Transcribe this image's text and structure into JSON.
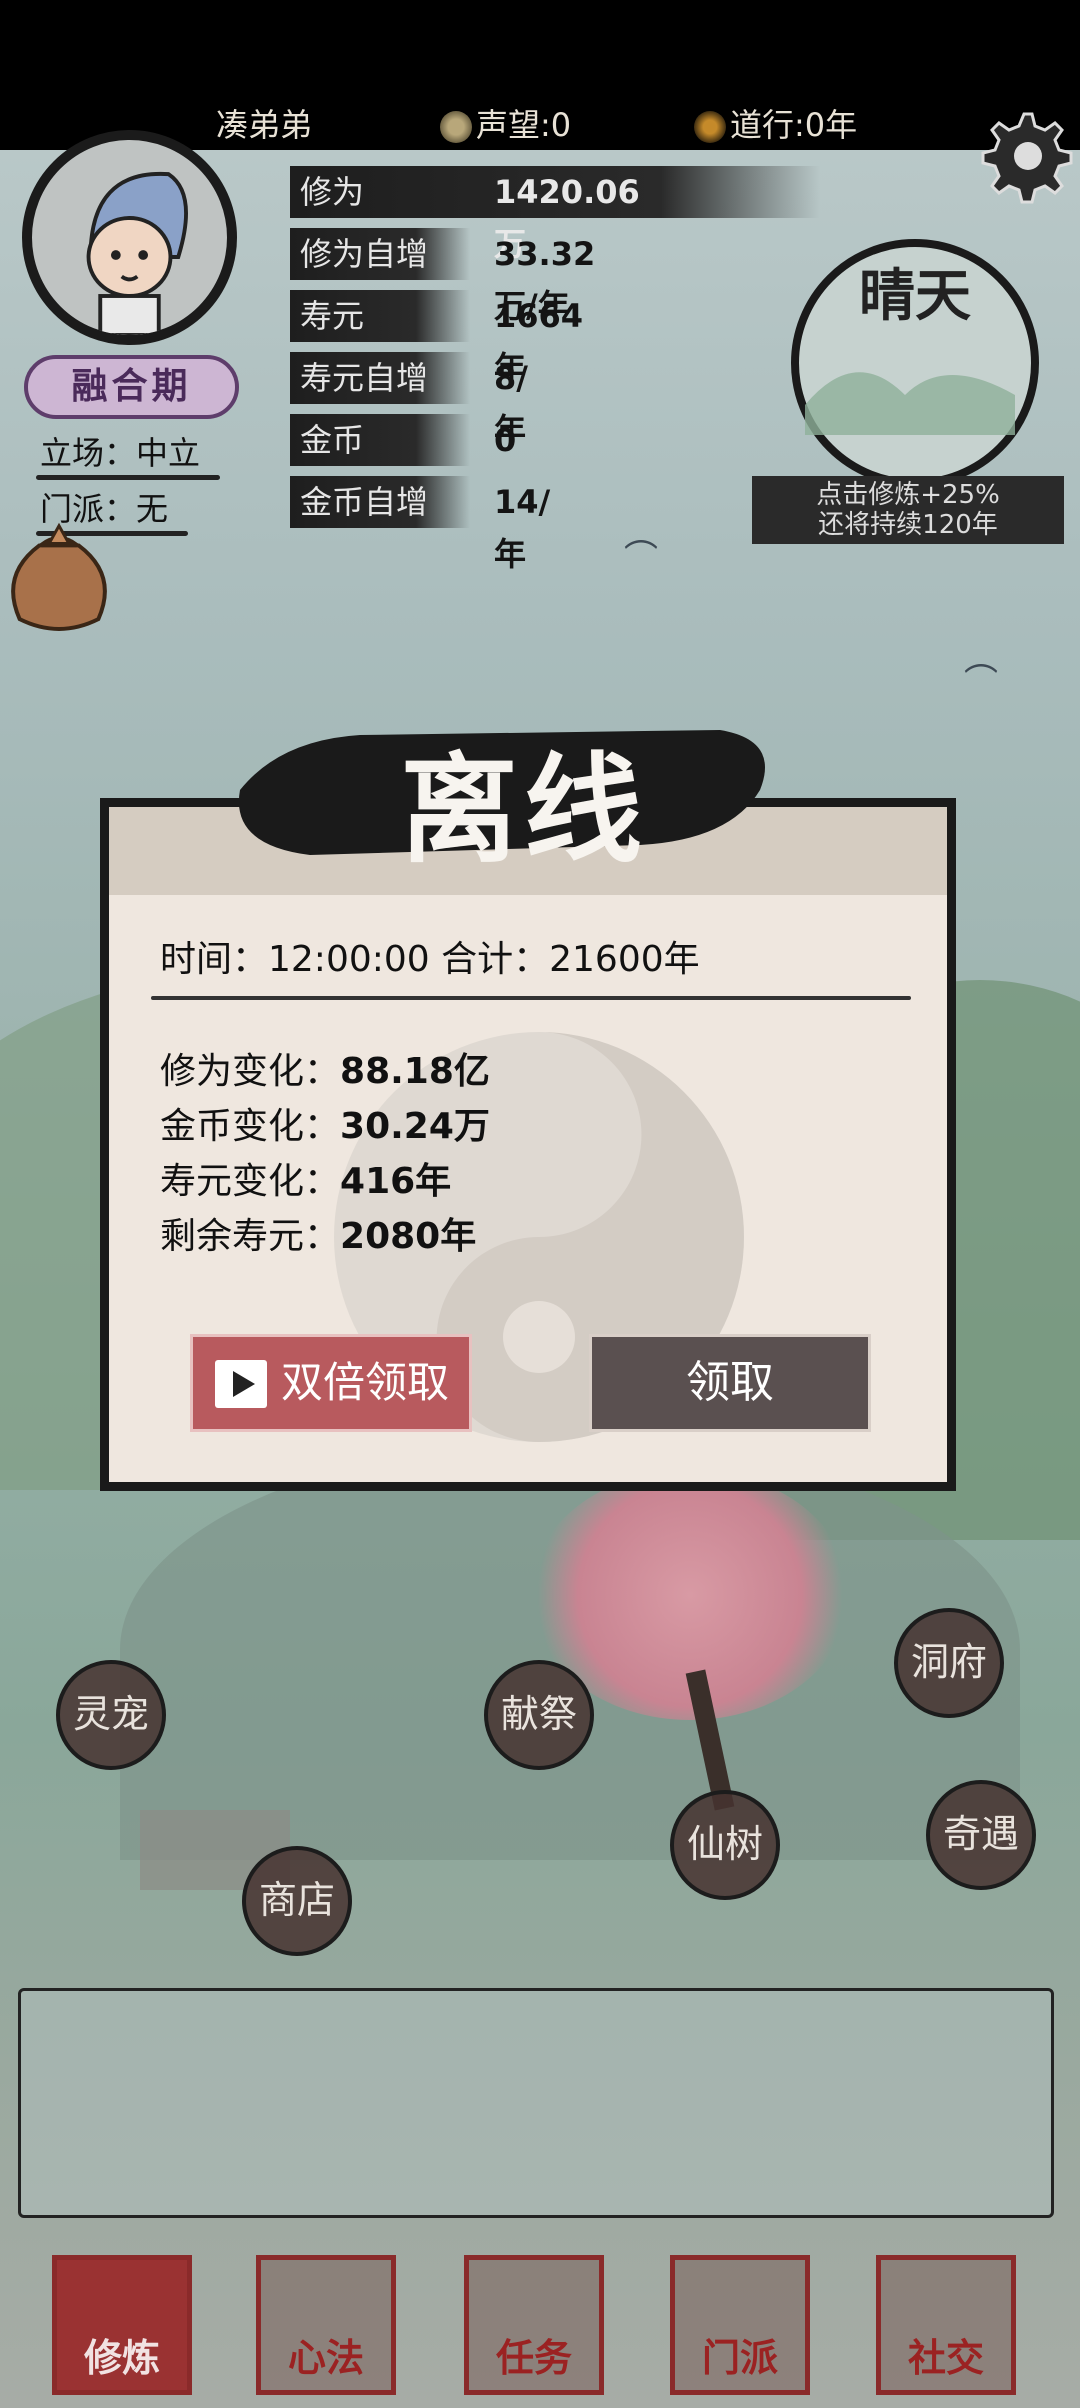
{
  "header": {
    "player_name": "凑弟弟",
    "reputation": "声望:0",
    "dao": "道行:0年"
  },
  "profile": {
    "rank": "融合期",
    "stance": "立场：中立",
    "sect": "门派：无"
  },
  "stats": [
    {
      "label": "修为",
      "value": "1420.06万"
    },
    {
      "label": "修为自增",
      "value": "33.32万/年"
    },
    {
      "label": "寿元",
      "value": "1664年"
    },
    {
      "label": "寿元自增",
      "value": "8/年"
    },
    {
      "label": "金币",
      "value": "0"
    },
    {
      "label": "金币自增",
      "value": "14/年"
    }
  ],
  "weather": {
    "name": "晴天",
    "line1": "点击修炼+25%",
    "line2": "还将持续120年"
  },
  "dialog": {
    "title": "离线",
    "time_row": "时间：12:00:00 合计：21600年",
    "changes": [
      {
        "label": "修为变化：",
        "value": "88.18亿"
      },
      {
        "label": "金币变化：",
        "value": "30.24万"
      },
      {
        "label": "寿元变化：",
        "value": "416年"
      },
      {
        "label": "剩余寿元：",
        "value": "2080年"
      }
    ],
    "double_label": "双倍领取",
    "claim_label": "领取"
  },
  "map_buttons": {
    "pet": "灵宠",
    "sacrifice": "献祭",
    "cave": "洞府",
    "shop": "商店",
    "tree": "仙树",
    "adventure": "奇遇"
  },
  "tabs": [
    "修炼",
    "心法",
    "任务",
    "门派",
    "社交"
  ],
  "colors": {
    "accent_red": "#9a3232",
    "double_button": "#b85a5e",
    "claim_button": "#5a5050",
    "dialog_bg": "#efe7df"
  },
  "icons": {
    "reputation": "coin-icon",
    "dao": "yin-yang-icon",
    "settings": "gear-icon",
    "bag": "bag-icon",
    "double": "play-video-icon"
  }
}
